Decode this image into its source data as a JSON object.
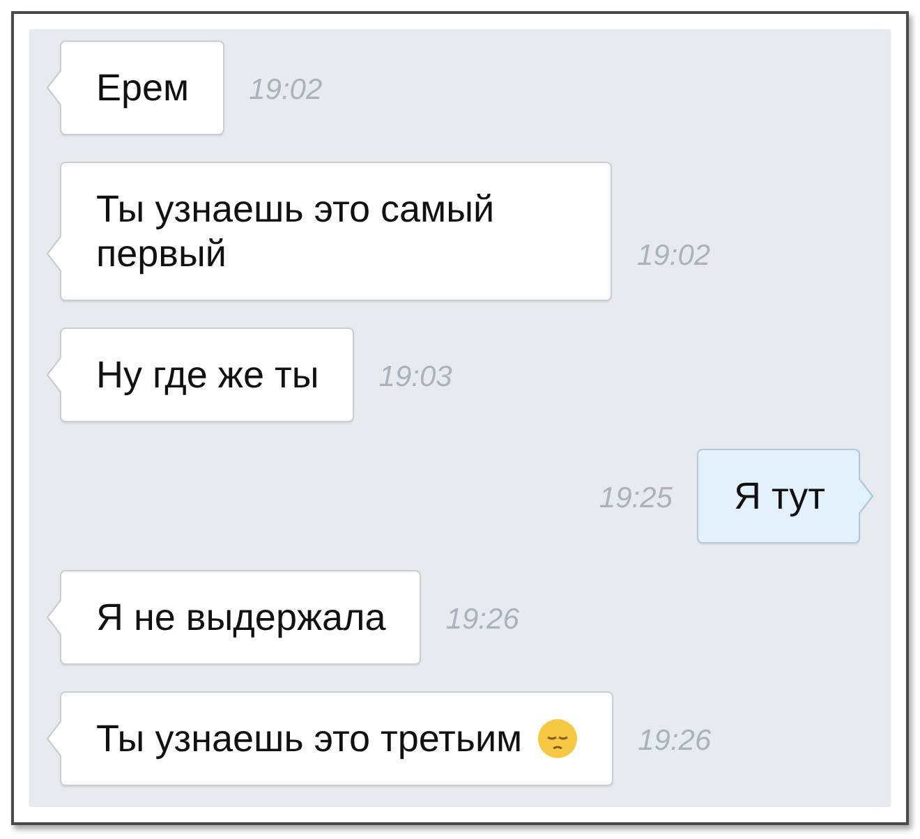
{
  "messages": [
    {
      "kind": "incoming",
      "text": "Ерем",
      "time": "19:02",
      "emoji": false
    },
    {
      "kind": "incoming",
      "text": "Ты узнаешь это самый первый",
      "time": "19:02",
      "emoji": false
    },
    {
      "kind": "incoming",
      "text": "Ну где же ты",
      "time": "19:03",
      "emoji": false
    },
    {
      "kind": "outgoing",
      "text": "Я тут",
      "time": "19:25",
      "emoji": false
    },
    {
      "kind": "incoming",
      "text": "Я не выдержала",
      "time": "19:26",
      "emoji": false
    },
    {
      "kind": "incoming",
      "text": "Ты узнаешь это третьим",
      "time": "19:26",
      "emoji": true
    }
  ]
}
